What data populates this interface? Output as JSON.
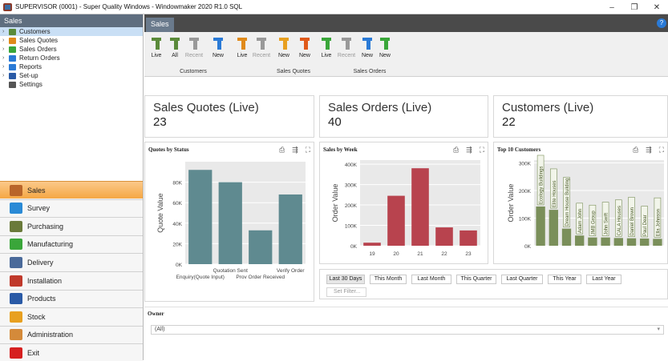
{
  "window": {
    "title": "SUPERVISOR (0001) - Super Quality Windows - Windowmaker 2020 R1.0 SQL",
    "minimize": "–",
    "maximize": "❐",
    "close": "✕"
  },
  "sidebar": {
    "header": "Sales",
    "tree": [
      {
        "label": "Customers",
        "color": "#5a8a3a",
        "selected": true
      },
      {
        "label": "Sales Quotes",
        "color": "#e08a1a"
      },
      {
        "label": "Sales Orders",
        "color": "#3aa63a"
      },
      {
        "label": "Return Orders",
        "color": "#2a7ad6"
      },
      {
        "label": "Reports",
        "color": "#2a7ad6"
      },
      {
        "label": "Set-up",
        "color": "#2a5aa6"
      },
      {
        "label": "Settings",
        "color": "#555555"
      }
    ],
    "nav": [
      {
        "label": "Sales",
        "color": "#b9652a",
        "active": true
      },
      {
        "label": "Survey",
        "color": "#2a8ad6"
      },
      {
        "label": "Purchasing",
        "color": "#6a7a3a"
      },
      {
        "label": "Manufacturing",
        "color": "#3aa63a"
      },
      {
        "label": "Delivery",
        "color": "#4a6a9a"
      },
      {
        "label": "Installation",
        "color": "#c0392b"
      },
      {
        "label": "Products",
        "color": "#2a5aa6"
      },
      {
        "label": "Stock",
        "color": "#e8a020"
      },
      {
        "label": "Administration",
        "color": "#d48a3a"
      },
      {
        "label": "Exit",
        "color": "#d62020"
      }
    ]
  },
  "tab": {
    "label": "Sales",
    "help": "?"
  },
  "ribbon": {
    "buttons": [
      {
        "label": "Live",
        "icon": "customers-live-icon",
        "color": "#5a8a3a"
      },
      {
        "label": "All",
        "icon": "customers-all-icon",
        "color": "#5a8a3a"
      },
      {
        "label": "Recent",
        "icon": "recent-icon",
        "color": "#999999",
        "disabled": true
      },
      {
        "label": "New",
        "icon": "new-icon",
        "color": "#2a7ad6"
      },
      {
        "label": "Live",
        "icon": "quotes-live-icon",
        "color": "#e08a1a"
      },
      {
        "label": "Recent",
        "icon": "recent-icon",
        "color": "#999999",
        "disabled": true
      },
      {
        "label": "New",
        "icon": "new-icon",
        "color": "#e8a020"
      },
      {
        "label": "New",
        "icon": "new-icon",
        "color": "#e05a1a"
      },
      {
        "label": "Live",
        "icon": "orders-live-icon",
        "color": "#3aa63a"
      },
      {
        "label": "Recent",
        "icon": "recent-icon",
        "color": "#999999",
        "disabled": true
      },
      {
        "label": "New",
        "icon": "new-icon",
        "color": "#2a7ad6"
      },
      {
        "label": "New",
        "icon": "new-icon",
        "color": "#3aa63a"
      }
    ],
    "groups": [
      "Customers",
      "Sales Quotes",
      "Sales Orders"
    ]
  },
  "tiles": [
    {
      "title": "Sales Quotes (Live)",
      "value": "23"
    },
    {
      "title": "Sales Orders (Live)",
      "value": "40"
    },
    {
      "title": "Customers (Live)",
      "value": "22"
    }
  ],
  "panel_icons": [
    "⎙",
    "⇶",
    "⛶"
  ],
  "chart_data": [
    {
      "type": "bar",
      "title": "Quotes by Status",
      "ylabel": "Quote Value",
      "yticks": [
        "0K",
        "20K",
        "40K",
        "60K",
        "80K"
      ],
      "ylim": [
        0,
        100000
      ],
      "categories": [
        "Enquiry(Quote Input)",
        "Quotation Sent",
        "Prov Order Received",
        "Verify Order"
      ],
      "values": [
        92000,
        80000,
        33000,
        68000
      ],
      "color": "#5f8a90"
    },
    {
      "type": "bar",
      "title": "Sales by Week",
      "ylabel": "Order Value",
      "yticks": [
        "0K",
        "100K",
        "200K",
        "300K",
        "400K"
      ],
      "ylim": [
        0,
        420000
      ],
      "categories": [
        "19",
        "20",
        "21",
        "22",
        "23"
      ],
      "values": [
        15000,
        245000,
        380000,
        90000,
        75000
      ],
      "color": "#b8434e"
    },
    {
      "type": "bar",
      "title": "Top 10 Customers",
      "ylabel": "Order Value",
      "yticks": [
        "0K",
        "100K",
        "200K",
        "300K"
      ],
      "ylim": [
        0,
        310000
      ],
      "categories": [
        "Ecology Buildings",
        "Elite Houses",
        "Dream House Building",
        "Adam John",
        "JMB Group",
        "John Swift",
        "CALA Houses",
        "Daniel Brown",
        "Paul Dear",
        "Ella Johnson"
      ],
      "values": [
        142000,
        130000,
        62000,
        37000,
        30000,
        30000,
        28000,
        27000,
        26000,
        25000
      ],
      "color": "#7a8f5a"
    }
  ],
  "filters": {
    "buttons": [
      "Last 30 Days",
      "This Month",
      "Last Month",
      "This Quarter",
      "Last Quarter",
      "This Year",
      "Last Year"
    ],
    "active": "Last 30 Days",
    "set_filter": "Set Filter..."
  },
  "owner": {
    "label": "Owner",
    "value": "(All)",
    "dropdown": "▾"
  }
}
